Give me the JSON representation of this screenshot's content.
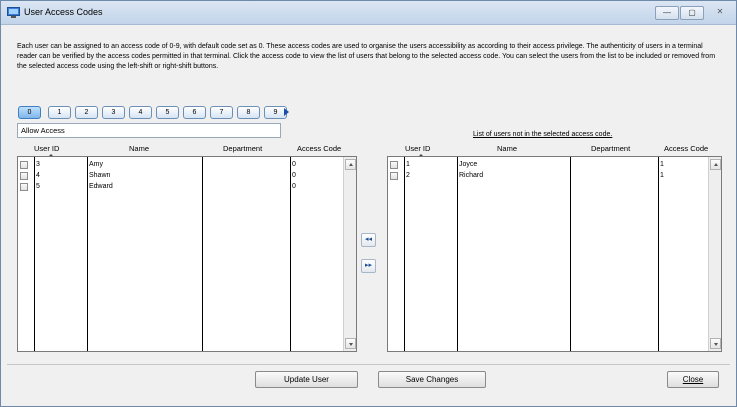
{
  "window": {
    "title": "User Access Codes",
    "minimize_label": "—",
    "maximize_label": "▢",
    "close_label": "✕"
  },
  "description": "Each user can be assigned to an access code of 0-9, with default code set as 0. These access codes are used to organise the users accessibility as according to their access privilege. The authenticity of users in a terminal reader can be verified by the access codes permitted in that terminal. Click the access code to view the list of users that belong to the selected access code. You can select the users from the list to be included or removed from the selected access code using the left-shift or right-shift buttons.",
  "access_codes": {
    "buttons": [
      "0",
      "1",
      "2",
      "3",
      "4",
      "5",
      "6",
      "7",
      "8",
      "9"
    ],
    "selected": "0",
    "code_name_value": "Allow Access"
  },
  "left_list": {
    "columns": [
      "User ID",
      "Name",
      "Department",
      "Access Code"
    ],
    "rows": [
      {
        "user_id": "3",
        "name": "Amy",
        "department": "",
        "access_code": "0"
      },
      {
        "user_id": "4",
        "name": "Shawn",
        "department": "",
        "access_code": "0"
      },
      {
        "user_id": "5",
        "name": "Edward",
        "department": "",
        "access_code": "0"
      }
    ]
  },
  "right_list": {
    "caption": "List of users not in the selected access code.",
    "columns": [
      "User ID",
      "Name",
      "Department",
      "Access Code"
    ],
    "rows": [
      {
        "user_id": "1",
        "name": "Joyce",
        "department": "",
        "access_code": "1"
      },
      {
        "user_id": "2",
        "name": "Richard",
        "department": "",
        "access_code": "1"
      }
    ]
  },
  "move_buttons": {
    "left_label": "◂◂",
    "right_label": "▸▸"
  },
  "footer": {
    "update_user_label": "Update User",
    "save_changes_label": "Save Changes",
    "close_label": "Close"
  },
  "colors": {
    "title_bar": "#c9d9ee",
    "selected_code": "#7fb6ea",
    "arrow": "#1a4ea8"
  }
}
